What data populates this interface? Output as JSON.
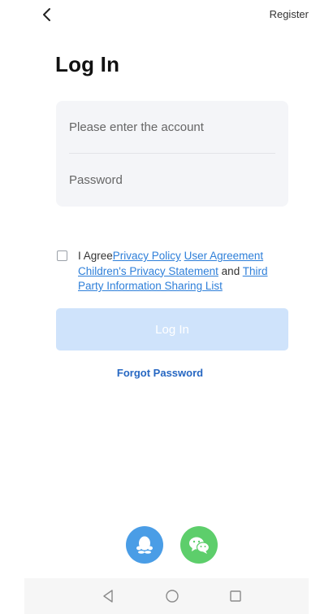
{
  "header": {
    "back_icon": "chevron-left-icon",
    "register_label": "Register"
  },
  "title": "Log In",
  "form": {
    "account_placeholder": "Please enter the account",
    "account_value": "",
    "password_placeholder": "Password",
    "password_value": ""
  },
  "agreement": {
    "checked": false,
    "prefix": "I Agree",
    "privacy_policy": "Privacy Policy",
    "user_agreement": "User Agreement",
    "children_privacy": "Children's Privacy Statement",
    "conjunction": "and",
    "third_party": "Third Party Information Sharing List"
  },
  "login_button_label": "Log In",
  "forgot_password_label": "Forgot Password",
  "social": {
    "qq_icon": "qq-penguin-icon",
    "wechat_icon": "wechat-icon"
  },
  "nav": {
    "back": "triangle-back-icon",
    "home": "circle-home-icon",
    "recents": "square-recents-icon"
  },
  "colors": {
    "accent": "#2e7fd9",
    "button_disabled": "#cfe3fb",
    "qq": "#4a9de6",
    "wechat": "#5dce6b"
  }
}
